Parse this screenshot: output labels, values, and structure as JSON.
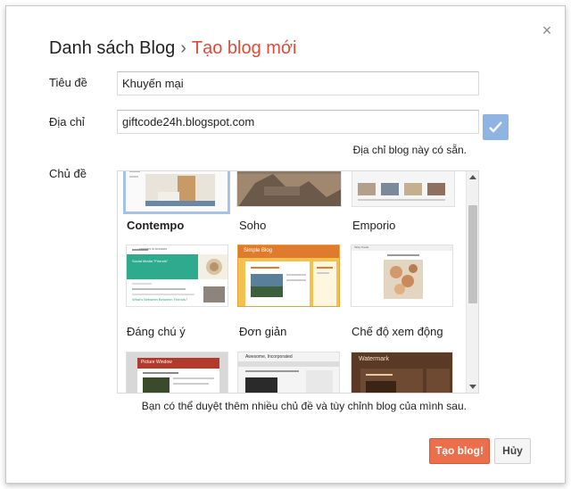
{
  "dialog": {
    "breadcrumb_parent": "Danh sách Blog",
    "breadcrumb_separator": "›",
    "breadcrumb_current": "Tạo blog mới",
    "close_symbol": "×"
  },
  "form": {
    "title_label": "Tiêu đề",
    "title_value": "Khuyến mại",
    "address_label": "Địa chỉ",
    "address_value": "giftcode24h.blogspot.com",
    "address_status": "Địa chỉ blog này có sẵn.",
    "theme_label": "Chủ đề"
  },
  "themes": [
    {
      "name": "Contempo",
      "selected": true
    },
    {
      "name": "Soho",
      "selected": false
    },
    {
      "name": "Emporio",
      "selected": false
    },
    {
      "name": "Đáng chú ý",
      "selected": false
    },
    {
      "name": "Đơn giản",
      "selected": false
    },
    {
      "name": "Chế độ xem động",
      "selected": false
    },
    {
      "name": "",
      "selected": false
    },
    {
      "name": "",
      "selected": false
    },
    {
      "name": "",
      "selected": false
    }
  ],
  "thumb_text": {
    "simple": "Simple Blog",
    "picture_window": "Picture Window",
    "awesome": "Awesome, Incorporated",
    "watermark": "Watermark",
    "notable_heading": "Social Media \"Friends\"",
    "notable_post": "What's Between Between Friends?",
    "dynamic_heading": "Tasty Treats",
    "notable_brand": "FRIENDS IN MODERN"
  },
  "hint": "Bạn có thể duyệt thêm nhiều chủ đề và tùy chỉnh blog của mình sau.",
  "buttons": {
    "create": "Tạo blog!",
    "cancel": "Hủy"
  },
  "colors": {
    "accent": "#dd4b39",
    "primary_button": "#ec6f4b",
    "check_button": "#8fb4e1",
    "selected_border": "#a8c1e6"
  },
  "icons": {
    "close": "close-icon",
    "check": "check-icon",
    "scroll_up": "arrow-up-icon",
    "scroll_down": "arrow-down-icon"
  }
}
